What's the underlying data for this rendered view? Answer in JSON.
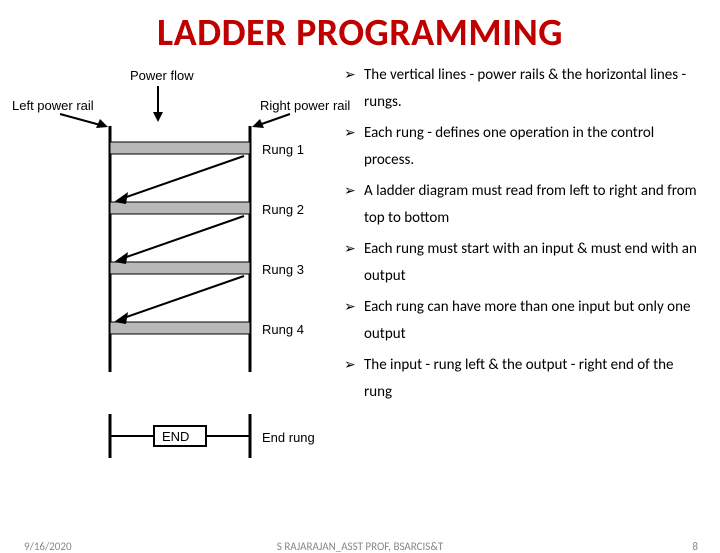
{
  "title": "LADDER PROGRAMMING",
  "diagram": {
    "power_flow": "Power flow",
    "left_rail": "Left power rail",
    "right_rail": "Right power rail",
    "rung1": "Rung 1",
    "rung2": "Rung 2",
    "rung3": "Rung 3",
    "rung4": "Rung 4",
    "end_box": "END",
    "end_rung": "End rung"
  },
  "bullets": {
    "b1": "The vertical lines - power rails & the horizontal lines - rungs.",
    "b2": "Each rung - defines one operation in the control process.",
    "b3": "A ladder diagram must read from left to right and from top to bottom",
    "b4": "Each rung must start with an input & must end with an output",
    "b5": "Each rung can have more than one input but only one output",
    "b6": "The input - rung left & the output - right end of the rung"
  },
  "footer": {
    "date": "9/16/2020",
    "center": "S RAJARAJAN_ASST PROF, BSARCIS&T",
    "page": "8"
  }
}
